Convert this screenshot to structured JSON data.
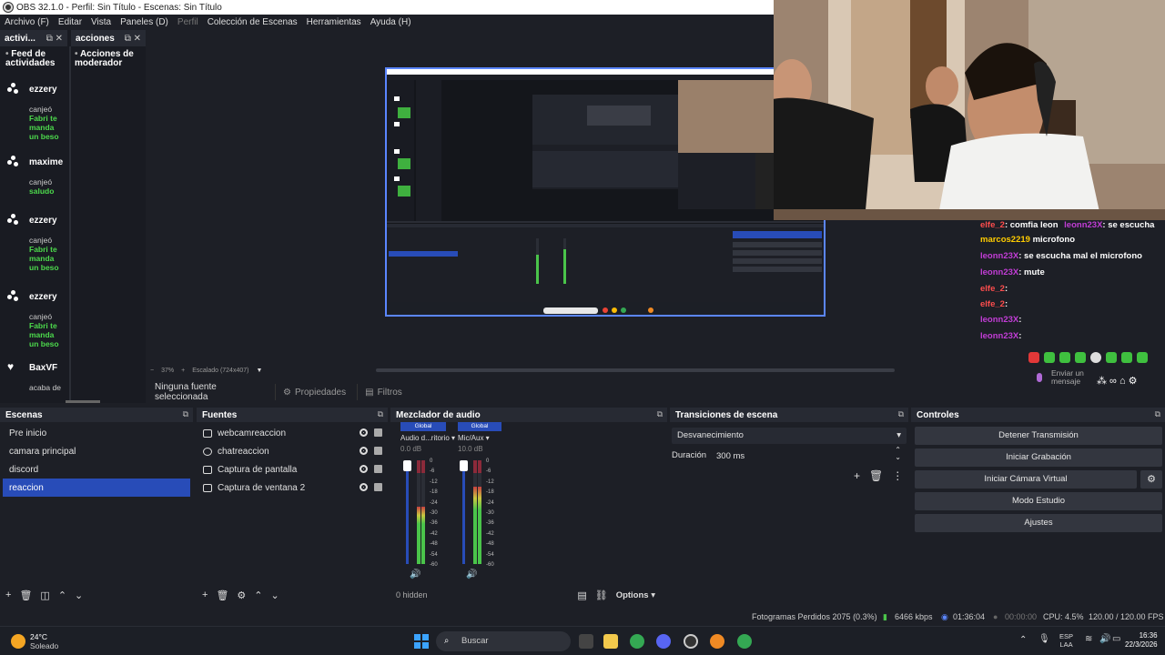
{
  "window": {
    "title": "OBS 32.1.0 - Perfil: Sin Título - Escenas: Sin Título"
  },
  "menu": [
    {
      "label": "Archivo (F)",
      "enabled": true
    },
    {
      "label": "Editar",
      "enabled": true
    },
    {
      "label": "Vista",
      "enabled": true
    },
    {
      "label": "Paneles (D)",
      "enabled": true
    },
    {
      "label": "Perfil",
      "enabled": false
    },
    {
      "label": "Colección de Escenas",
      "enabled": true
    },
    {
      "label": "Herramientas",
      "enabled": true
    },
    {
      "label": "Ayuda (H)",
      "enabled": true
    }
  ],
  "left_dock": {
    "tab1": "activi...",
    "tab2": "acciones",
    "feed_title": "Feed de actividades",
    "mod_title": "Acciones de moderador",
    "items": [
      {
        "user": "ezzery",
        "verb": "canjeó",
        "text": "Fabri te manda un beso"
      },
      {
        "user": "maxime",
        "verb": "canjeó",
        "text": "saludo"
      },
      {
        "user": "ezzery",
        "verb": "canjeó",
        "text": "Fabri te manda un beso"
      },
      {
        "user": "ezzery",
        "verb": "canjeó",
        "text": "Fabri te manda un beso"
      },
      {
        "user": "BaxVF",
        "verb": "acaba de",
        "text": ""
      }
    ]
  },
  "chat": {
    "lines": [
      {
        "user": "elfe_2",
        "msg": ": comfia leon",
        "color": "#ff4d4d"
      },
      {
        "user": "leonn23X",
        "msg": ": se escucha",
        "color": "#c23dd6"
      },
      {
        "user": "marcos2219",
        "msg": " microfono",
        "color": "#ffcc00"
      },
      {
        "user": "leonn23X",
        "msg": ": se escucha mal el microfono",
        "color": "#c23dd6"
      },
      {
        "user": "leonn23X",
        "msg": ": mute",
        "color": "#c23dd6"
      },
      {
        "user": "elfe_2",
        "msg": ":",
        "color": "#ff4d4d"
      },
      {
        "user": "elfe_2",
        "msg": ":",
        "color": "#ff4d4d"
      },
      {
        "user": "leonn23X",
        "msg": ":",
        "color": "#c23dd6"
      },
      {
        "user": "leonn23X",
        "msg": ":",
        "color": "#c23dd6"
      }
    ],
    "send_placeholder": "Enviar un mensaje"
  },
  "preview": {
    "zoom": "37%",
    "scale_label": "Escalado (724x407)"
  },
  "source_bar": {
    "no_source": "Ninguna fuente seleccionada",
    "properties": "Propiedades",
    "filters": "Filtros"
  },
  "scenes": {
    "title": "Escenas",
    "items": [
      "Pre inicio",
      "camara principal",
      "discord",
      "reaccion"
    ],
    "selected_index": 3
  },
  "sources": {
    "title": "Fuentes",
    "items": [
      {
        "name": "webcamreaccion",
        "icon": "camera-icon"
      },
      {
        "name": "chatreaccion",
        "icon": "browser-icon"
      },
      {
        "name": "Captura de pantalla",
        "icon": "monitor-icon"
      },
      {
        "name": "Captura de ventana 2",
        "icon": "window-icon"
      }
    ]
  },
  "mixer": {
    "title": "Mezclador de audio",
    "channels": [
      {
        "group": "Global",
        "name": "Audio d...ritorio",
        "db": "0.0 dB",
        "level": 0.55
      },
      {
        "group": "Global",
        "name": "Mic/Aux",
        "db": "10.0 dB",
        "level": 0.75
      }
    ],
    "ticks": [
      "0",
      "-6",
      "-12",
      "-18",
      "-24",
      "-30",
      "-36",
      "-42",
      "-48",
      "-54",
      "-60"
    ],
    "hidden": "0 hidden",
    "options": "Options"
  },
  "transitions": {
    "title": "Transiciones de escena",
    "current": "Desvanecimiento",
    "duration_label": "Duración",
    "duration_value": "300 ms"
  },
  "controls": {
    "title": "Controles",
    "buttons": [
      "Detener Transmisión",
      "Iniciar Grabación",
      "Iniciar Cámara Virtual",
      "Modo Estudio",
      "Ajustes"
    ]
  },
  "status": {
    "dropped": "Fotogramas Perdidos 2075 (0.3%)",
    "bitrate": "6466 kbps",
    "stream_time": "01:36:04",
    "rec_time": "00:00:00",
    "cpu": "CPU: 4.5%",
    "fps": "120.00 / 120.00 FPS"
  },
  "taskbar": {
    "weather_temp": "24°C",
    "weather_desc": "Soleado",
    "search": "Buscar",
    "lang1": "ESP",
    "lang2": "LAA",
    "time": "16:36",
    "date": "22/3/2026"
  },
  "colors": {
    "accent": "#284cb8",
    "panel": "#1d1f26",
    "header": "#272a33"
  }
}
